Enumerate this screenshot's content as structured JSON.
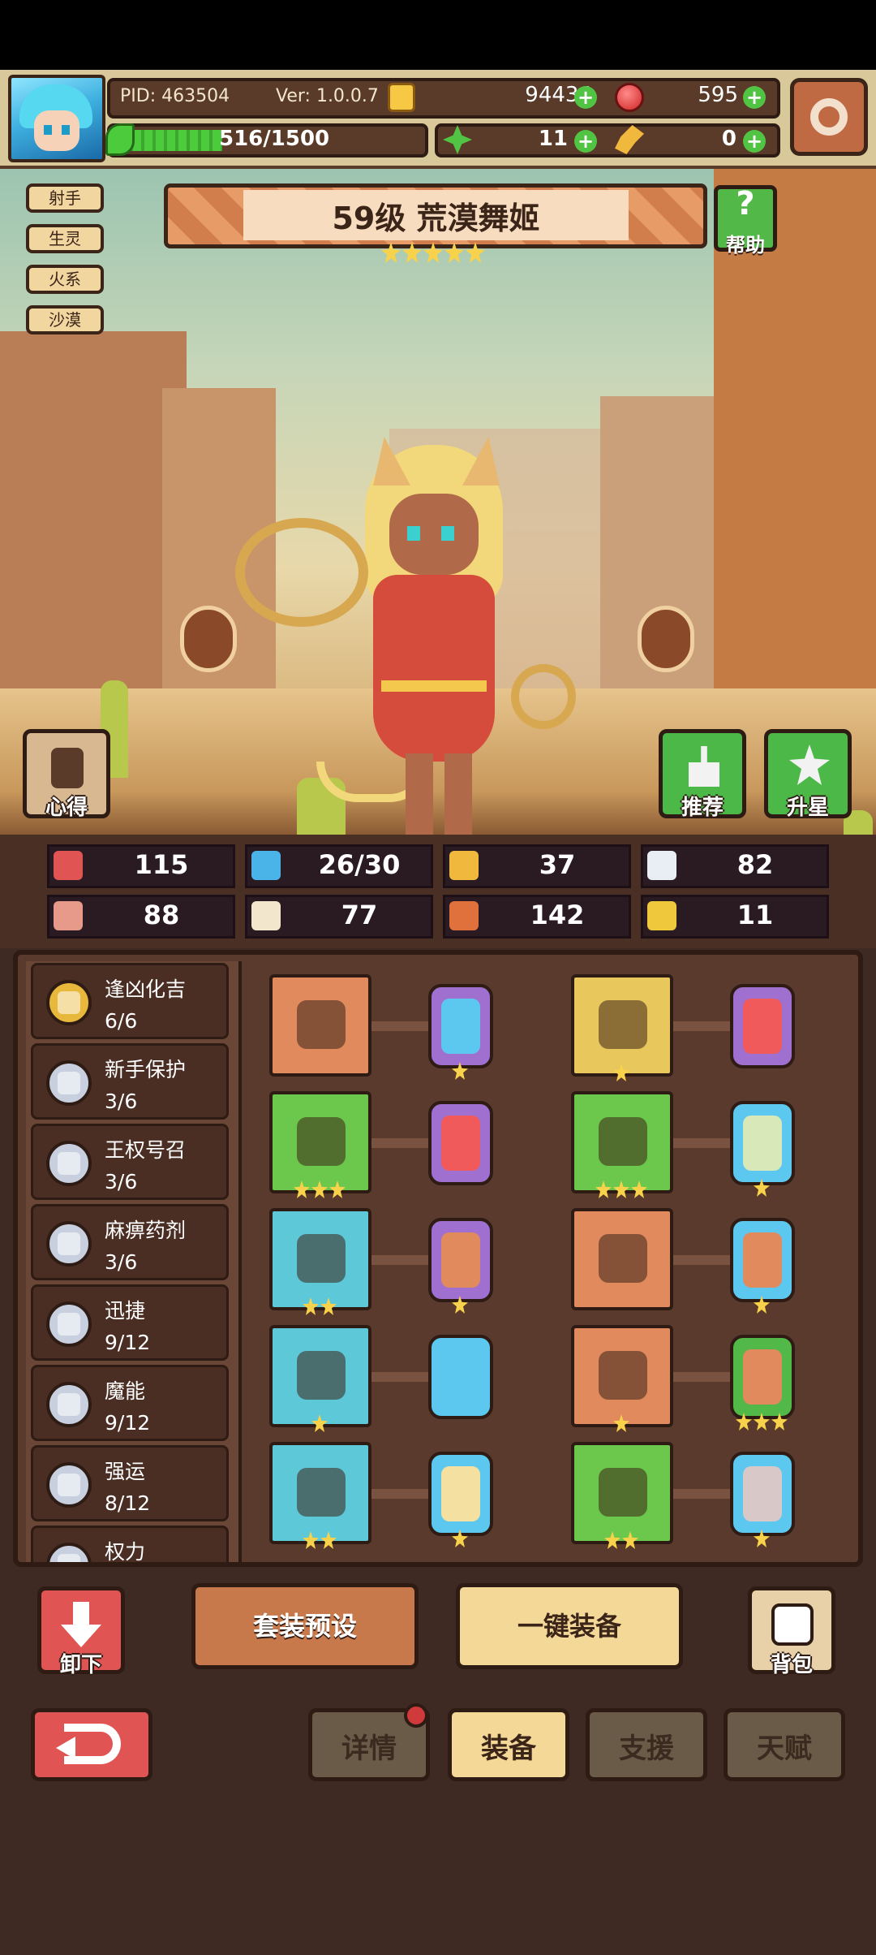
{
  "header": {
    "pid": "PID: 463504",
    "version": "Ver: 1.0.0.7",
    "coins": "94434",
    "gems": "595",
    "xp": "516/1500",
    "xp_progress": 0.344,
    "clovers": "11",
    "keys": "0"
  },
  "hero": {
    "title": "59级 荒漠舞姬",
    "star_count": 5,
    "tags": [
      "射手",
      "生灵",
      "火系",
      "沙漠"
    ]
  },
  "buttons": {
    "help": "帮助",
    "notes": "心得",
    "recommend": "推荐",
    "star_up": "升星",
    "unequip": "卸下",
    "preset": "套装预设",
    "equip_all": "一键装备",
    "bag": "背包"
  },
  "stats": [
    {
      "icon": "heart-icon",
      "value": "115",
      "color": "#e05454"
    },
    {
      "icon": "water-drop-icon",
      "value": "26/30",
      "color": "#4ab4e8"
    },
    {
      "icon": "shield-icon",
      "value": "37",
      "color": "#f0b83c"
    },
    {
      "icon": "wing-icon",
      "value": "82",
      "color": "#e8eef4"
    },
    {
      "icon": "fist-icon",
      "value": "88",
      "color": "#e89a8a"
    },
    {
      "icon": "book-icon",
      "value": "77",
      "color": "#f2e6cc"
    },
    {
      "icon": "magic-card-icon",
      "value": "142",
      "color": "#e0703c"
    },
    {
      "icon": "horseshoe-icon",
      "value": "11",
      "color": "#f0c83c"
    }
  ],
  "sets": [
    {
      "name": "逢凶化吉",
      "count": "6/6",
      "color": "#e8b83c"
    },
    {
      "name": "新手保护",
      "count": "3/6",
      "color": "#c8d0e0"
    },
    {
      "name": "王权号召",
      "count": "3/6",
      "color": "#c8d0e0"
    },
    {
      "name": "麻痹药剂",
      "count": "3/6",
      "color": "#c8d0e0"
    },
    {
      "name": "迅捷",
      "count": "9/12",
      "color": "#c8d0e0"
    },
    {
      "name": "魔能",
      "count": "9/12",
      "color": "#c8d0e0"
    },
    {
      "name": "强运",
      "count": "8/12",
      "color": "#c8d0e0"
    },
    {
      "name": "权力",
      "count": "",
      "color": "#c8d0e0"
    }
  ],
  "equipment": [
    {
      "gear": "scepter-icon",
      "gear_bg": "#e08a5e",
      "gear_stars": 0,
      "gem_color": "#5cc8f0",
      "gem_border": "#a070d0",
      "gem_stars": 1
    },
    {
      "gear": "crown-icon",
      "gear_bg": "#e8c85c",
      "gear_stars": 1,
      "gem_color": "#f05a5a",
      "gem_border": "#a070d0",
      "gem_stars": 0
    },
    {
      "gear": "feather-icon",
      "gear_bg": "#6cc84c",
      "gear_stars": 3,
      "gem_color": "#f05a5a",
      "gem_border": "#a070d0",
      "gem_stars": 0
    },
    {
      "gear": "armor-icon",
      "gear_bg": "#6cc84c",
      "gear_stars": 3,
      "gem_color": "#d8e8b8",
      "gem_border": "#5cc8f0",
      "gem_stars": 1
    },
    {
      "gear": "necklace-icon",
      "gear_bg": "#5cc8d8",
      "gear_stars": 2,
      "gem_color": "#e08a5e",
      "gem_border": "#a070d0",
      "gem_stars": 1
    },
    {
      "gear": "sun-ring-icon",
      "gear_bg": "#e08a5e",
      "gear_stars": 0,
      "gem_color": "#e08a5e",
      "gem_border": "#5cc8f0",
      "gem_stars": 1
    },
    {
      "gear": "medallion-icon",
      "gear_bg": "#5cc8d8",
      "gear_stars": 1,
      "gem_color": "#5cc8f0",
      "gem_border": "#5cc8f0",
      "gem_stars": 0
    },
    {
      "gear": "belt-icon",
      "gear_bg": "#e08a5e",
      "gear_stars": 1,
      "gem_color": "#e08a5e",
      "gem_border": "#52b848",
      "gem_stars": 3
    },
    {
      "gear": "potion-icon",
      "gear_bg": "#5cc8d8",
      "gear_stars": 2,
      "gem_color": "#f4e0a0",
      "gem_border": "#5cc8f0",
      "gem_stars": 1
    },
    {
      "gear": "boots-icon",
      "gear_bg": "#6cc84c",
      "gear_stars": 2,
      "gem_color": "#d8c8c8",
      "gem_border": "#5cc8f0",
      "gem_stars": 1
    }
  ],
  "tabs": [
    "详情",
    "装备",
    "支援",
    "天赋"
  ],
  "active_tab": 1
}
